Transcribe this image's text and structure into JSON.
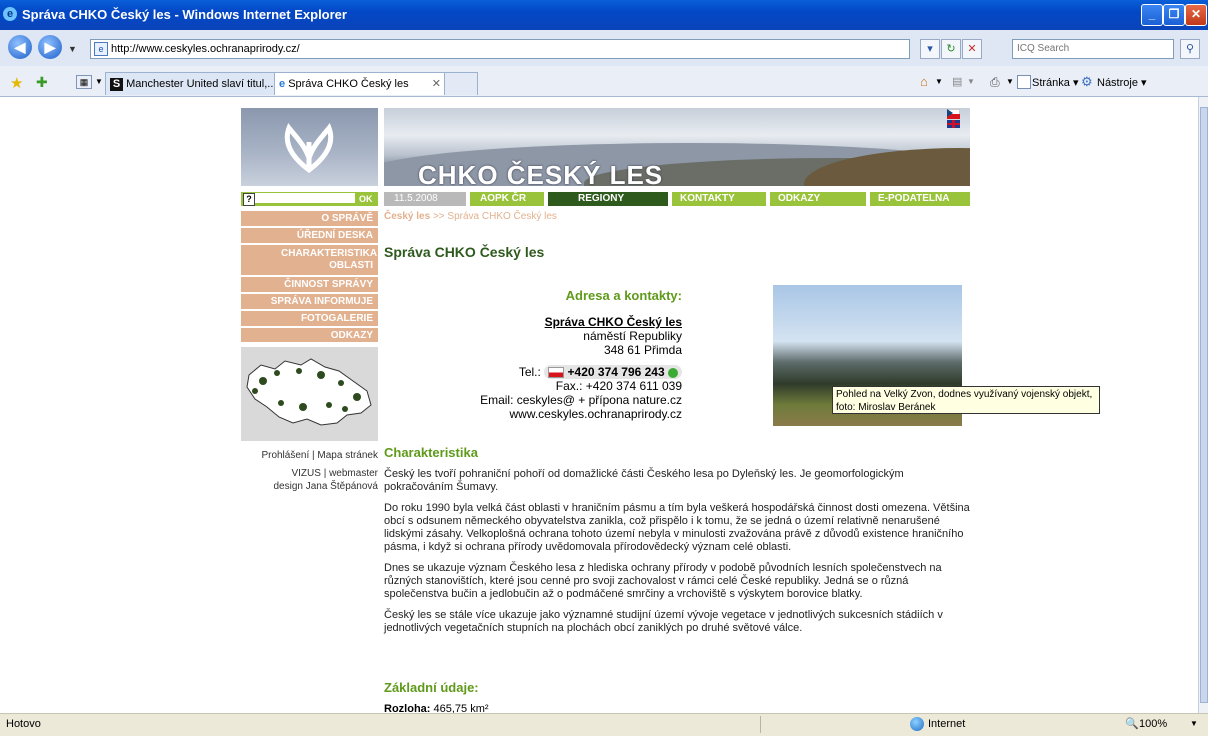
{
  "window": {
    "title": "Správa CHKO Český les - Windows Internet Explorer"
  },
  "toolbar": {
    "url": "http://www.ceskyles.ochranaprirody.cz/",
    "search_placeholder": "ICQ Search",
    "page_menu": "Stránka",
    "tools_menu": "Nástroje"
  },
  "tabs": [
    {
      "label": "Manchester United slaví titul,..."
    },
    {
      "label": "Správa CHKO Český les"
    }
  ],
  "page": {
    "banner_title": "CHKO ČESKÝ LES",
    "date": "11.5.2008",
    "search_button": "OK",
    "top_menu": [
      "AOPK ČR",
      "REGIONY",
      "KONTAKTY",
      "ODKAZY",
      "E-PODATELNA"
    ],
    "left_menu": [
      "O SPRÁVĚ",
      "ÚŘEDNÍ DESKA",
      "CHARAKTERISTIKA OBLASTI",
      "ČINNOST SPRÁVY",
      "SPRÁVA INFORMUJE",
      "FOTOGALERIE",
      "ODKAZY"
    ],
    "breadcrumb": {
      "home": "Český les",
      "sep": ">>",
      "current": "Správa CHKO Český les"
    },
    "heading": "Správa CHKO Český les",
    "contact": {
      "heading": "Adresa a kontakty:",
      "org": "Správa CHKO Český les",
      "street": "náměstí Republiky",
      "city": "348 61 Přimda",
      "tel_label": "Tel.:",
      "tel": "+420 374 796 243",
      "fax": "Fax.: +420 374 611 039",
      "email": "Email: ceskyles@ + přípona nature.cz",
      "web": "www.ceskyles.ochranaprirody.cz"
    },
    "photo_tooltip_1": "Pohled na Velký Zvon, dodnes využívaný vojenský objekt,",
    "photo_tooltip_2": "foto: Miroslav Beránek",
    "footer_left": {
      "links": "Prohlášení | Mapa stránek",
      "vizus": "VIZUS | webmaster",
      "design": "design Jana Štěpánová"
    },
    "char_heading": "Charakteristika",
    "paragraphs": [
      "Český les tvoří pohraniční pohoří od domažlické části Českého lesa po Dyleňský les. Je geomorfologickým pokračováním Šumavy.",
      "Do roku 1990 byla velká část oblasti v hraničním pásmu a tím byla veškerá hospodářská činnost dosti omezena. Většina obcí s odsunem německého obyvatelstva zanikla, což přispělo i k tomu, že se jedná o území relativně nenarušené lidskými zásahy. Velkoplošná ochrana tohoto území nebyla v minulosti zvažována právě z důvodů existence hraničního pásma, i když si ochrana přírody uvědomovala přírodovědecký význam celé oblasti.",
      "Dnes se ukazuje význam Českého lesa z hlediska ochrany přírody v podobě původních lesních společenstvech na různých stanovištích, které jsou cenné pro svoji zachovalost v rámci celé České republiky. Jedná se o různá společenstva bučin a jedlobučin až o podmáčené smrčiny a vrchoviště s výskytem borovice blatky.",
      "Český les se stále více ukazuje jako významné studijní území vývoje vegetace v jednotlivých sukcesních stádiích v jednotlivých vegetačních stupních na plochách obcí zaniklých po druhé světové válce."
    ],
    "basic_heading": "Základní údaje:",
    "area_label": "Rozloha:",
    "area_value": "465,75 km²"
  },
  "statusbar": {
    "left": "Hotovo",
    "zone": "Internet",
    "zoom": "100%"
  },
  "colors": {
    "green_text": "#5f9a1a",
    "menu_green": "#9ac33c",
    "menu_dark_green": "#2f5a1e",
    "left_menu_bg": "#e2b18f"
  }
}
